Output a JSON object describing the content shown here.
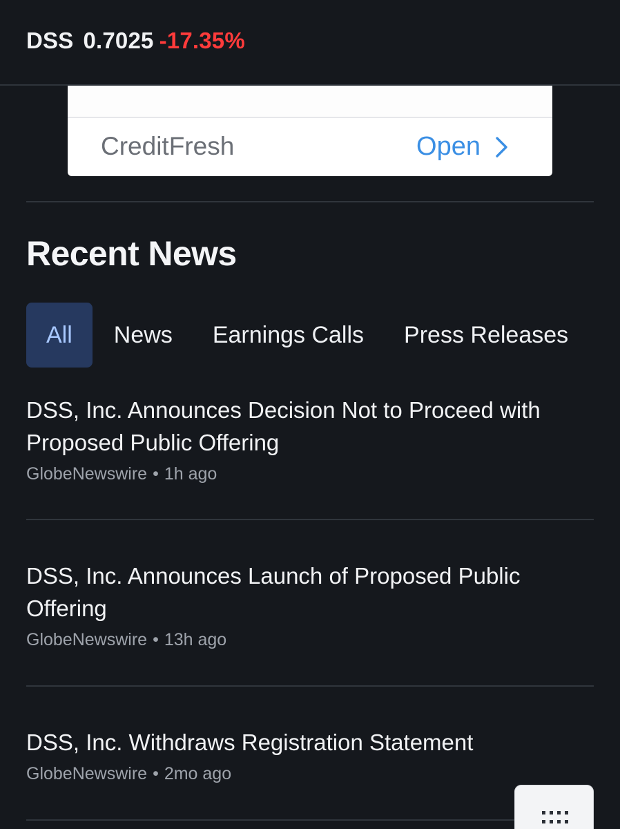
{
  "header": {
    "symbol": "DSS",
    "price": "0.7025",
    "change": "-17.35%",
    "change_color": "#ff3b3b"
  },
  "ad": {
    "brand": "CreditFresh",
    "cta": "Open",
    "cta_icon": "chevron-right-icon",
    "cta_color": "#3b8fe4"
  },
  "recent_news": {
    "title": "Recent News",
    "tabs": [
      {
        "label": "All",
        "active": true
      },
      {
        "label": "News",
        "active": false
      },
      {
        "label": "Earnings Calls",
        "active": false
      },
      {
        "label": "Press Releases",
        "active": false
      }
    ],
    "items": [
      {
        "title": "DSS, Inc. Announces Decision Not to Proceed with Proposed Public Offering",
        "source": "GlobeNewswire",
        "time": "1h ago"
      },
      {
        "title": "DSS, Inc. Announces Launch of Proposed Public Offering",
        "source": "GlobeNewswire",
        "time": "13h ago"
      },
      {
        "title": "DSS, Inc. Withdraws Registration Statement",
        "source": "GlobeNewswire",
        "time": "2mo ago"
      }
    ]
  },
  "floating_button": {
    "icon": "grid-dots-icon"
  }
}
